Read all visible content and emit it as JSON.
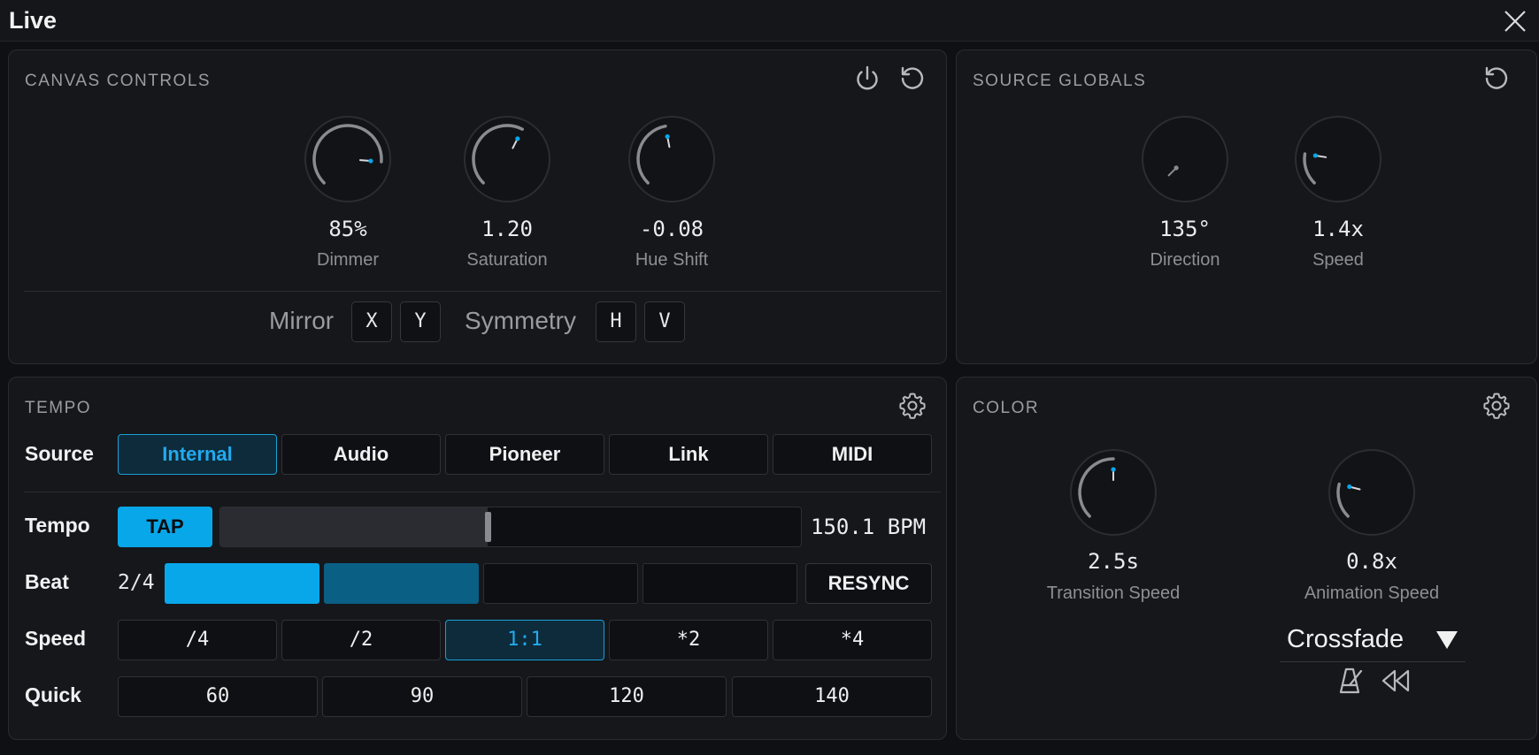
{
  "window": {
    "title": "Live"
  },
  "canvas_controls": {
    "title": "CANVAS CONTROLS",
    "knobs": [
      {
        "value": "85%",
        "label": "Dimmer",
        "level": 0.85
      },
      {
        "value": "1.20",
        "label": "Saturation",
        "level": 0.6
      },
      {
        "value": "-0.08",
        "label": "Hue Shift",
        "level": 0.46
      }
    ],
    "mirror_label": "Mirror",
    "mirror_x": "X",
    "mirror_y": "Y",
    "symmetry_label": "Symmetry",
    "symmetry_h": "H",
    "symmetry_v": "V"
  },
  "source_globals": {
    "title": "SOURCE GLOBALS",
    "knobs": [
      {
        "value": "135°",
        "label": "Direction",
        "level": 0.0
      },
      {
        "value": "1.4x",
        "label": "Speed",
        "level": 0.2
      }
    ]
  },
  "tempo": {
    "title": "TEMPO",
    "source_label": "Source",
    "sources": [
      "Internal",
      "Audio",
      "Pioneer",
      "Link",
      "MIDI"
    ],
    "active_source": "Internal",
    "tempo_label": "Tempo",
    "tap_label": "TAP",
    "tempo_fraction": 0.46,
    "bpm": "150.1 BPM",
    "beat_label": "Beat",
    "beat_count": "2/4",
    "beats_on": 2,
    "resync_label": "RESYNC",
    "speed_label": "Speed",
    "speeds": [
      "/4",
      "/2",
      "1:1",
      "*2",
      "*4"
    ],
    "active_speed": "1:1",
    "quick_label": "Quick",
    "quick": [
      "60",
      "90",
      "120",
      "140"
    ]
  },
  "color": {
    "title": "COLOR",
    "knobs": [
      {
        "value": "2.5s",
        "label": "Transition Speed",
        "level": 0.5
      },
      {
        "value": "0.8x",
        "label": "Animation Speed",
        "level": 0.22
      }
    ],
    "transition_mode": "Crossfade"
  },
  "colors": {
    "accent": "#08a7ea",
    "accent_dim": "#0a5f85",
    "track": "#8a8b90"
  }
}
